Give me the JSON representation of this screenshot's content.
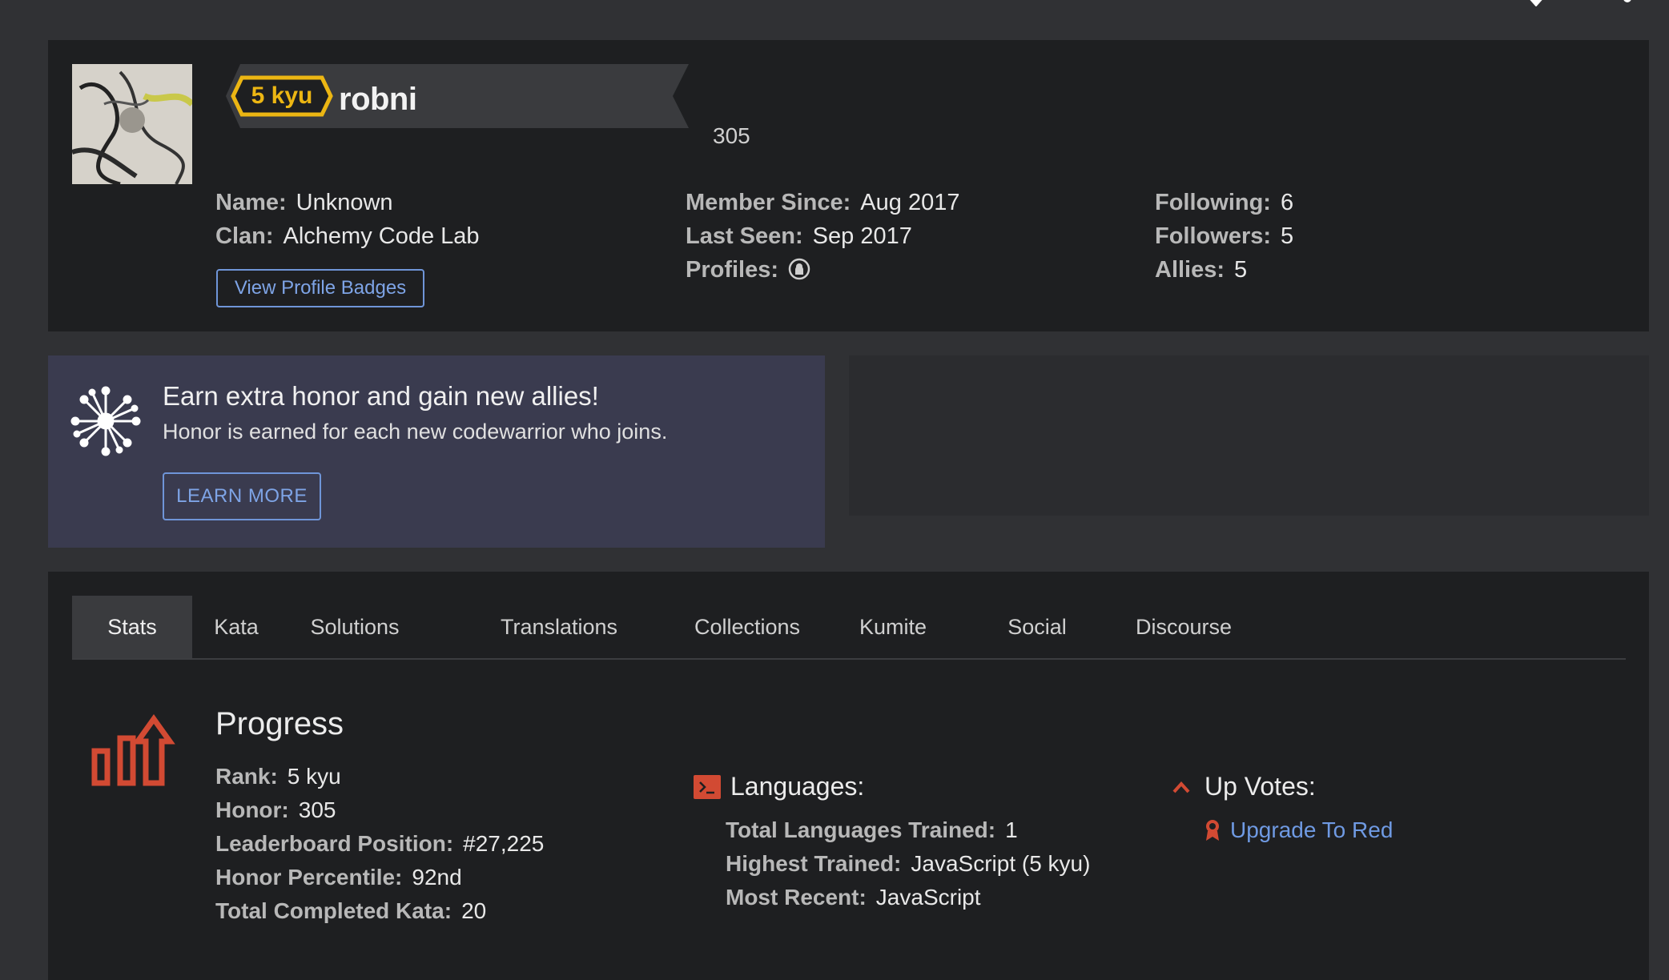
{
  "profile": {
    "rank_badge": "5 kyu",
    "username": "robni",
    "honor": "305",
    "col1": [
      {
        "label": "Name:",
        "value": "Unknown"
      },
      {
        "label": "Clan:",
        "value": "Alchemy Code Lab"
      }
    ],
    "col2": [
      {
        "label": "Member Since:",
        "value": "Aug 2017"
      },
      {
        "label": "Last Seen:",
        "value": "Sep 2017"
      },
      {
        "label": "Profiles:",
        "icon": "github-icon"
      }
    ],
    "col3": [
      {
        "label": "Following:",
        "value": "6"
      },
      {
        "label": "Followers:",
        "value": "5"
      },
      {
        "label": "Allies:",
        "value": "5"
      }
    ],
    "badges_button": "View Profile Badges"
  },
  "promo": {
    "title": "Earn extra honor and gain new allies!",
    "subtitle": "Honor is earned for each new codewarrior who joins.",
    "button": "LEARN MORE"
  },
  "tabs": [
    "Stats",
    "Kata",
    "Solutions",
    "Translations",
    "Collections",
    "Kumite",
    "Social",
    "Discourse"
  ],
  "active_tab": "Stats",
  "progress": {
    "title": "Progress",
    "items": [
      {
        "label": "Rank:",
        "value": "5 kyu"
      },
      {
        "label": "Honor:",
        "value": "305"
      },
      {
        "label": "Leaderboard Position:",
        "value": "#27,225"
      },
      {
        "label": "Honor Percentile:",
        "value": "92nd"
      },
      {
        "label": "Total Completed Kata:",
        "value": "20"
      }
    ]
  },
  "languages": {
    "title": "Languages:",
    "items": [
      {
        "label": "Total Languages Trained:",
        "value": "1"
      },
      {
        "label": "Highest Trained:",
        "value": "JavaScript (5 kyu)"
      },
      {
        "label": "Most Recent:",
        "value": "JavaScript"
      }
    ]
  },
  "upvotes": {
    "title": "Up Votes:",
    "link": "Upgrade To Red"
  },
  "colors": {
    "accent_red": "#d24a33",
    "rank_yellow": "#ecb613",
    "link_blue": "#6f9ae3"
  }
}
